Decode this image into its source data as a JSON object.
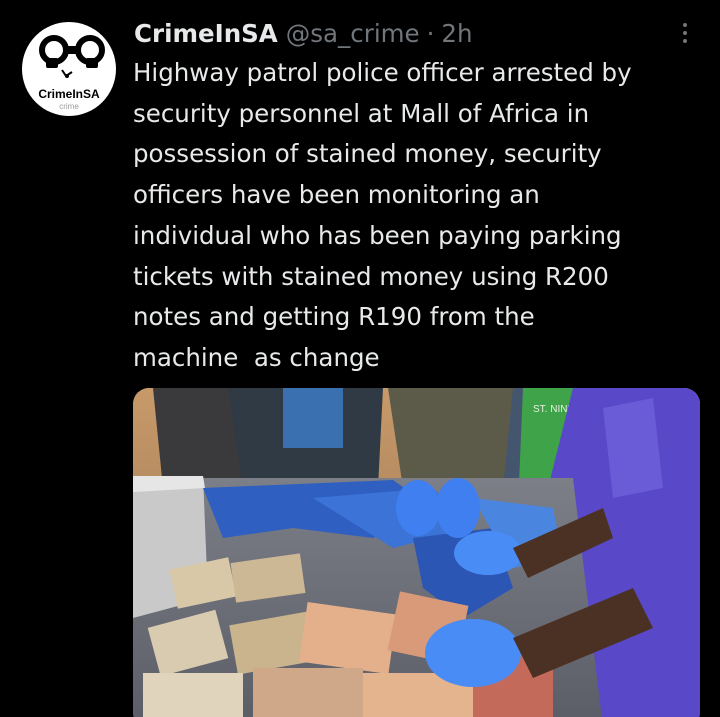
{
  "tweet": {
    "avatar": {
      "label": "CrimeInSA",
      "sublabel": "crime",
      "icon": "handcuffs-icon"
    },
    "author": {
      "display_name": "CrimeInSA",
      "handle": "@sa_crime",
      "separator": "·",
      "time": "2h"
    },
    "more_icon": "more-vertical-icon",
    "text_lines": [
      "Highway patrol police officer arrested by",
      "security personnel at Mall of Africa in",
      "possession of stained money, security",
      "officers have been monitoring an",
      "individual who has been paying parking",
      "tickets with stained money using R200",
      "notes and getting R190 from the",
      "machine  as change"
    ],
    "media": {
      "shirt_text": "ST. NINETEEN"
    }
  },
  "colors": {
    "background": "#000000",
    "text_primary": "#e7e9ea",
    "text_secondary": "#71767b"
  }
}
